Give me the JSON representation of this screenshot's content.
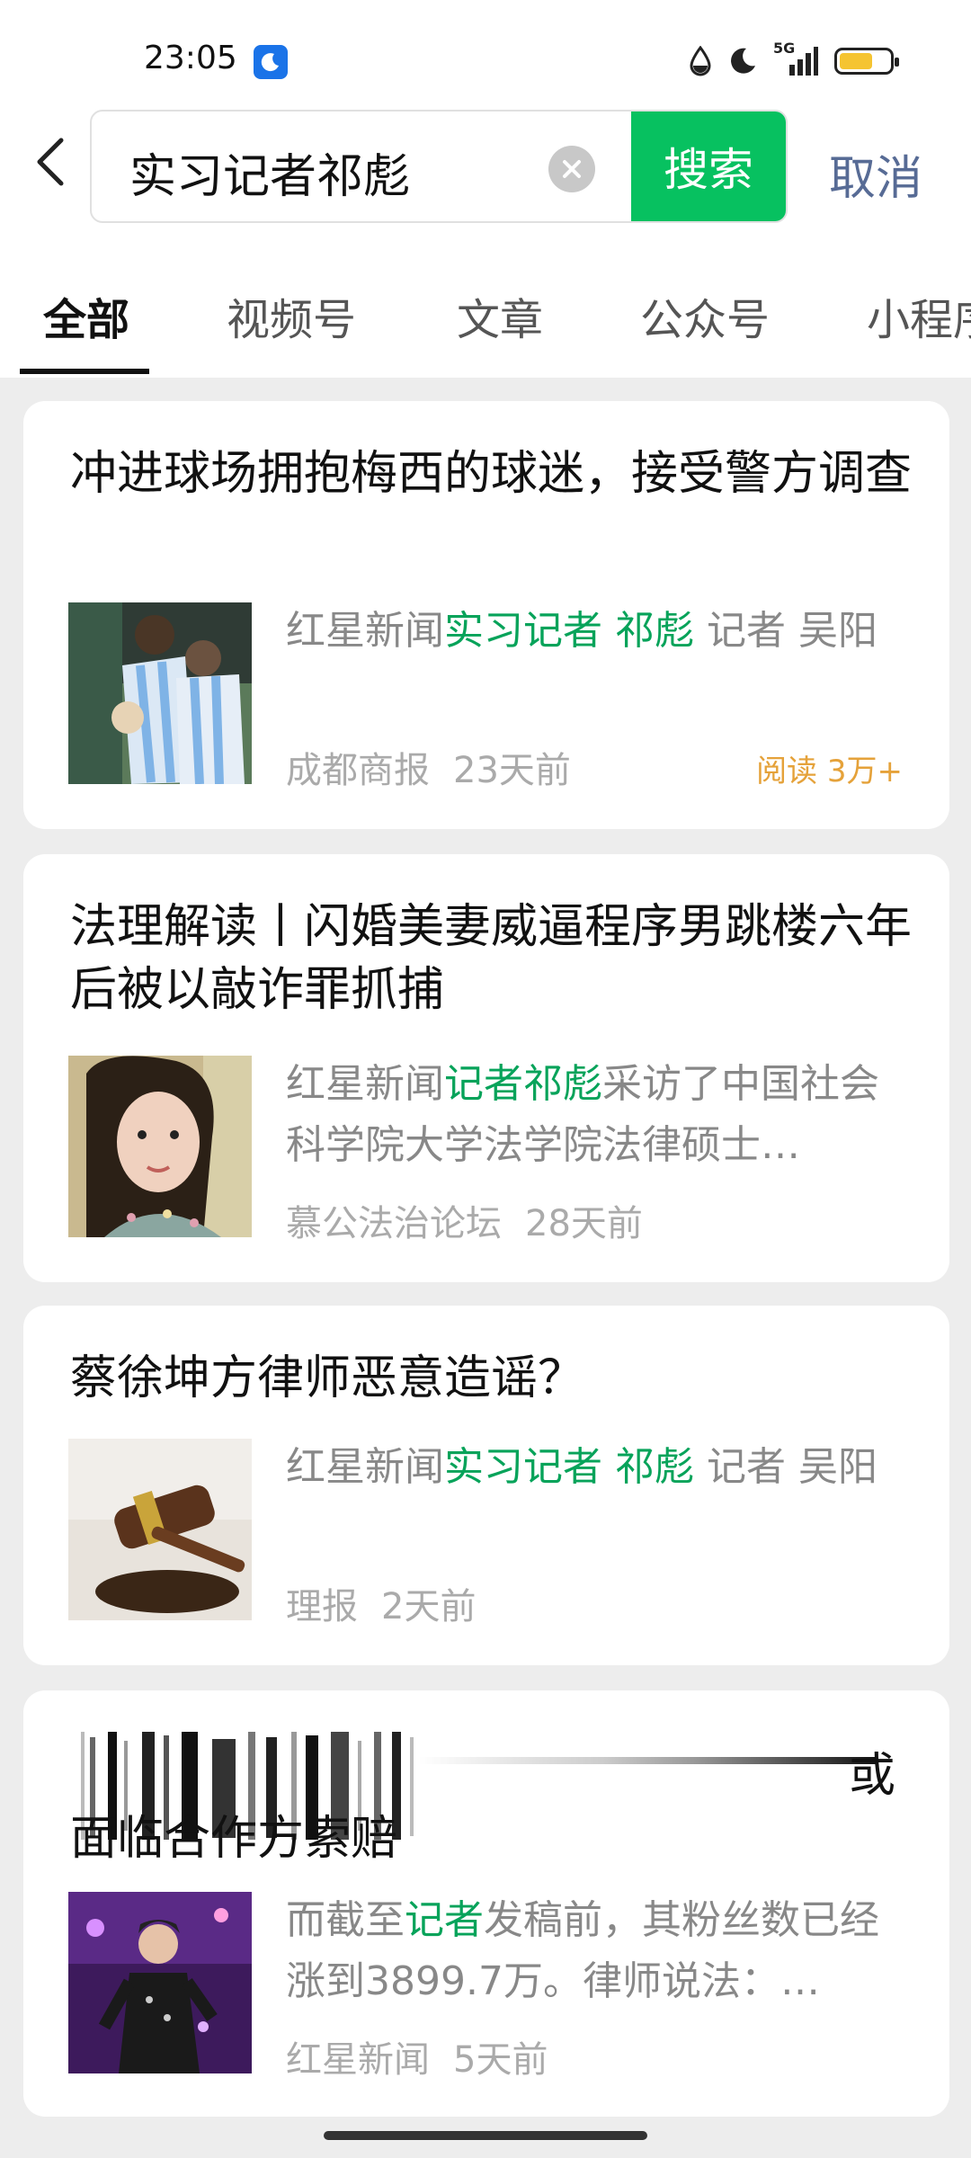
{
  "status_bar": {
    "time": "23:05",
    "network": "5G",
    "battery_level": 0.55,
    "icons": [
      "moon-badge-icon",
      "water-drop-icon",
      "moon-icon",
      "signal-icon",
      "battery-icon"
    ]
  },
  "search": {
    "query": "实习记者祁彪",
    "search_label": "搜索",
    "cancel_label": "取消"
  },
  "tabs": [
    {
      "label": "全部",
      "active": true
    },
    {
      "label": "视频号",
      "active": false
    },
    {
      "label": "文章",
      "active": false
    },
    {
      "label": "公众号",
      "active": false
    },
    {
      "label": "小程序",
      "active": false
    }
  ],
  "results": [
    {
      "title": "冲进球场拥抱梅西的球迷，接受警方调查",
      "snippet_pre": "红星新闻",
      "snippet_hl": "实习记者 祁彪",
      "snippet_post": " 记者 吴阳",
      "source": "成都商报",
      "time": "23天前",
      "reads": "阅读 3万+",
      "thumb_icon": "football-players-image"
    },
    {
      "title": "法理解读丨闪婚美妻威逼程序男跳楼六年后被以敲诈罪抓捕",
      "snippet_pre": "红星新闻",
      "snippet_hl": "记者祁彪",
      "snippet_post": "采访了中国社会科学院大学法学院法律硕士…",
      "source": "慕公法治论坛",
      "time": "28天前",
      "thumb_icon": "woman-portrait-image"
    },
    {
      "title": "蔡徐坤方律师恶意造谣？",
      "snippet_pre": "红星新闻",
      "snippet_hl": "实习记者 祁彪",
      "snippet_post": " 记者 吴阳",
      "source": "理报",
      "time": "2天前",
      "thumb_icon": "gavel-image"
    },
    {
      "title_end": "或",
      "title": "面临合作方索赔",
      "snippet_pre": "而截至",
      "snippet_hl": "记者",
      "snippet_post": "发稿前，其粉丝数已经涨到3899.7万。律师说法：…",
      "source": "红星新闻",
      "time": "5天前",
      "thumb_icon": "performer-stage-image"
    }
  ],
  "colors": {
    "accent_green": "#07c160",
    "highlight_green": "#07a35a",
    "cancel_blue": "#576b95",
    "reads_orange": "#e5a23a"
  }
}
